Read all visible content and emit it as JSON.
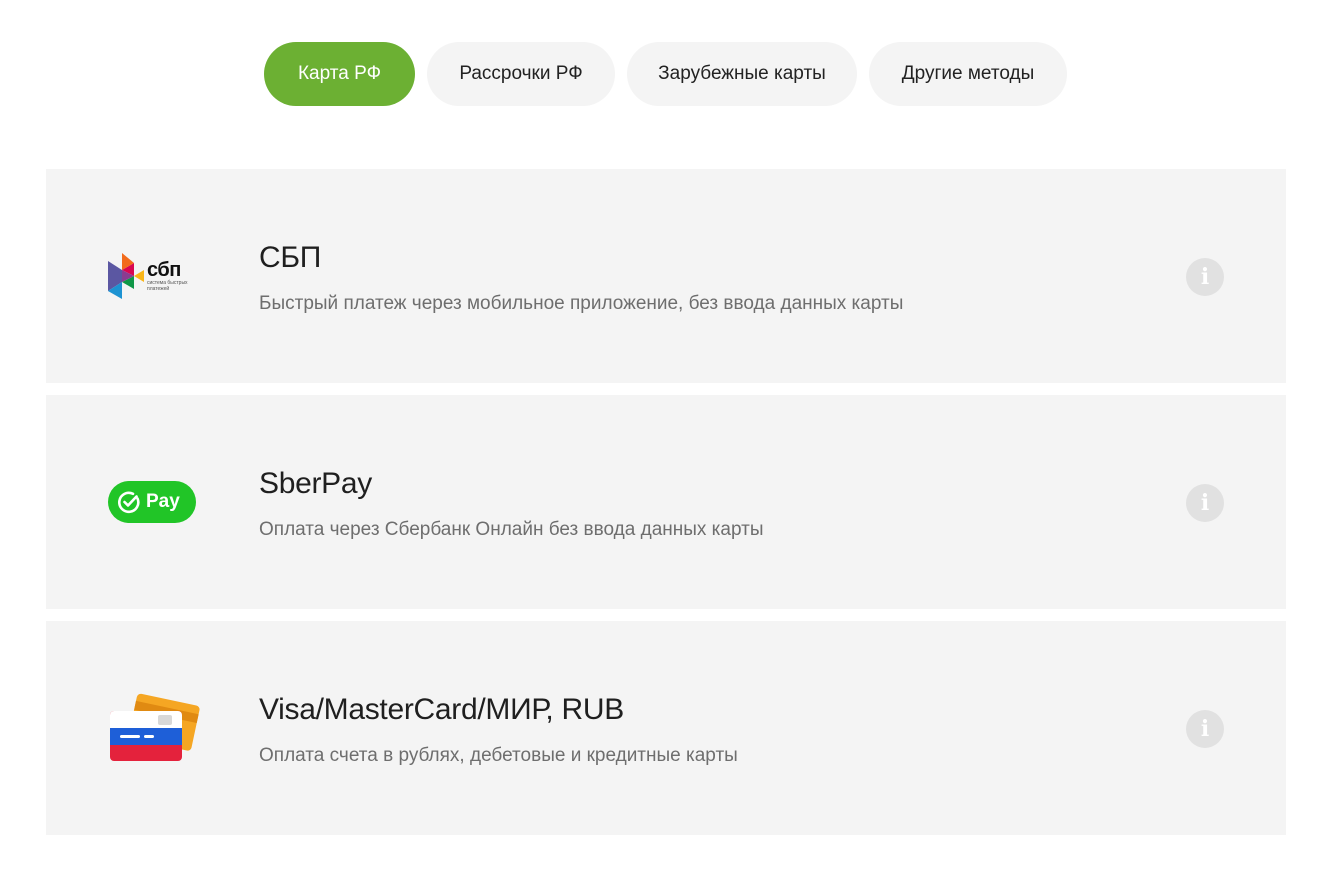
{
  "tabs": [
    {
      "label": "Карта РФ",
      "active": true
    },
    {
      "label": "Рассрочки РФ",
      "active": false
    },
    {
      "label": "Зарубежные карты",
      "active": false
    },
    {
      "label": "Другие методы",
      "active": false
    }
  ],
  "methods": [
    {
      "logo": "sbp-logo",
      "logo_text": "сбп",
      "logo_subtext": "система быстрых платежей",
      "title": "СБП",
      "description": "Быстрый платеж через мобильное приложение, без ввода данных карты"
    },
    {
      "logo": "sberpay-logo",
      "logo_text": "Pay",
      "title": "SberPay",
      "description": "Оплата через Сбербанк Онлайн без ввода данных карты"
    },
    {
      "logo": "bank-cards-icon",
      "title": "Visa/MasterCard/МИР, RUB",
      "description": "Оплата счета в рублях, дебетовые и кредитные карты"
    }
  ],
  "info_icon_glyph": "i",
  "colors": {
    "active_tab": "#6cb033",
    "inactive_tab": "#f4f4f4",
    "card_background": "#f4f4f4",
    "sberpay_green": "#21c527",
    "info_icon": "#e1e1e1"
  }
}
